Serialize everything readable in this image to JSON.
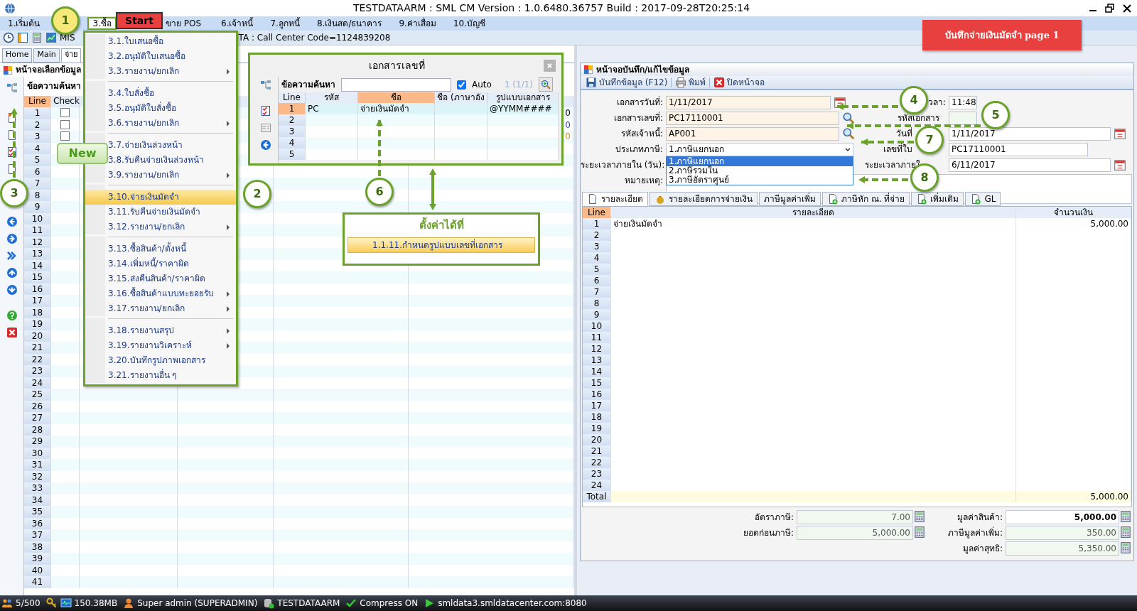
{
  "window": {
    "title": "TESTDATAARM : SML CM Version : 1.0.6480.36757  Build : 2017-09-28T20:25:14"
  },
  "menu_bar": [
    {
      "label": "1.เริ่มต้น",
      "selected": false
    },
    {
      "label": "3.ซื้อ",
      "selected": true
    },
    {
      "label": "ขาย POS",
      "selected": false
    },
    {
      "label": "6.เจ้าหนี้",
      "selected": false
    },
    {
      "label": "7.ลูกหนี้",
      "selected": false
    },
    {
      "label": "8.เงินสด/ธนาคาร",
      "selected": false
    },
    {
      "label": "9.ค่าเสื่อม",
      "selected": false
    },
    {
      "label": "10.บัญชี",
      "selected": false
    }
  ],
  "toolbar": {
    "mis_label": "MIS",
    "info": "TA : Call Center Code=1124839208"
  },
  "banner": "บันทึกจ่ายเงินมัดจำ page 1",
  "start_label": "Start",
  "left_panel": {
    "tabs": [
      {
        "label": "Home",
        "selected": false
      },
      {
        "label": "Main",
        "selected": false
      },
      {
        "label": "จ่าย",
        "selected": true
      }
    ],
    "title": "หน้าจอเลือกข้อมูล",
    "search_label": "ข้อความค้นหา",
    "columns": [
      "Line",
      "Check"
    ],
    "lines": [
      "1",
      "2",
      "3",
      "4",
      "5",
      "6",
      "7",
      "8",
      "9",
      "10",
      "11",
      "12",
      "13",
      "14",
      "15",
      "16",
      "17",
      "18",
      "19",
      "20",
      "21",
      "22",
      "23",
      "24",
      "25",
      "26",
      "27",
      "28",
      "29",
      "30",
      "31",
      "32",
      "33",
      "34",
      "35",
      "36",
      "37",
      "38",
      "39",
      "40",
      "41"
    ],
    "checks": [
      false,
      false,
      false
    ],
    "tails": [
      {
        "text": "0",
        "color": "#000000"
      },
      {
        "text": "0",
        "color": "#2a3fd0"
      },
      {
        "text": "0",
        "color": "#f08a00"
      }
    ]
  },
  "purchase_menu": [
    [
      {
        "label": "3.1.ใบเสนอซื้อ",
        "submenu": false,
        "selected": false
      },
      {
        "label": "3.2.อนุมัติใบเสนอซื้อ",
        "submenu": false,
        "selected": false
      },
      {
        "label": "3.3.รายงาน/ยกเลิก",
        "submenu": true,
        "selected": false
      }
    ],
    [
      {
        "label": "3.4.ใบสั่งซื้อ",
        "submenu": false,
        "selected": false
      },
      {
        "label": "3.5.อนุมัติใบสั่งซื้อ",
        "submenu": false,
        "selected": false
      },
      {
        "label": "3.6.รายงาน/ยกเลิก",
        "submenu": true,
        "selected": false
      }
    ],
    [
      {
        "label": "3.7.จ่ายเงินล่วงหน้า",
        "submenu": false,
        "selected": false
      },
      {
        "label": "3.8.รับคืนจ่ายเงินล่วงหน้า",
        "submenu": false,
        "selected": false
      },
      {
        "label": "3.9.รายงาน/ยกเลิก",
        "submenu": true,
        "selected": false
      }
    ],
    [
      {
        "label": "3.10.จ่ายเงินมัดจำ",
        "submenu": false,
        "selected": true
      },
      {
        "label": "3.11.รับคืนจ่ายเงินมัดจำ",
        "submenu": false,
        "selected": false
      },
      {
        "label": "3.12.รายงาน/ยกเลิก",
        "submenu": true,
        "selected": false
      }
    ],
    [
      {
        "label": "3.13.ซื้อสินค้า/ตั้งหนี้",
        "submenu": false,
        "selected": false
      },
      {
        "label": "3.14.เพิ่มหนี้/ราคาผิด",
        "submenu": false,
        "selected": false
      },
      {
        "label": "3.15.ส่งคืนสินค้า/ราคาผิด",
        "submenu": false,
        "selected": false
      },
      {
        "label": "3.16.ซื้อสินค้าแบบทะยอยรับ",
        "submenu": true,
        "selected": false
      },
      {
        "label": "3.17.รายงาน/ยกเลิก",
        "submenu": true,
        "selected": false
      }
    ],
    [
      {
        "label": "3.18.รายงานสรุป",
        "submenu": true,
        "selected": false
      },
      {
        "label": "3.19.รายงานวิเคราะห์",
        "submenu": true,
        "selected": false
      },
      {
        "label": "3.20.บันทึกรูปภาพเอกสาร",
        "submenu": false,
        "selected": false
      },
      {
        "label": "3.21.รายงานอื่น ๆ",
        "submenu": false,
        "selected": false
      }
    ]
  ],
  "popup": {
    "title": "เอกสารเลขที่",
    "search_label": "ข้อความค้นหา",
    "auto_checked": true,
    "auto_label": "Auto",
    "count": "1 (1/1)",
    "columns": [
      {
        "label": "Line",
        "selected": false
      },
      {
        "label": "รหัส",
        "selected": false
      },
      {
        "label": "ชื่อ",
        "selected": true
      },
      {
        "label": "ชื่อ (ภาษาอัง",
        "selected": false
      },
      {
        "label": "รูปแบบเอกสาร",
        "selected": false
      }
    ],
    "rows": [
      {
        "line": "1",
        "selected": true,
        "code": "PC",
        "name": "จ่ายเงินมัดจำ",
        "format": "@YYMM####"
      },
      {
        "line": "2",
        "selected": false
      },
      {
        "line": "3",
        "selected": false
      },
      {
        "line": "4",
        "selected": false
      },
      {
        "line": "5",
        "selected": false
      }
    ]
  },
  "setting_hint": {
    "title": "ตั้งค่าได้ที่",
    "item": "1.1.11.กำหนดรูปแบบเลขที่เอกสาร"
  },
  "new_tooltip": "New",
  "annotations": [
    {
      "label": "1",
      "color": "#f6e97a"
    },
    {
      "label": "3",
      "color": "#ffffff"
    },
    {
      "label": "2",
      "color": "#ffffff"
    },
    {
      "label": "4",
      "color": "#ffffff"
    },
    {
      "label": "5",
      "color": "#ffffff"
    },
    {
      "label": "6",
      "color": "#ffffff"
    },
    {
      "label": "7",
      "color": "#ffffff"
    },
    {
      "label": "8",
      "color": "#ffffff"
    }
  ],
  "form": {
    "title": "หน้าจอบันทึก/แก้ไขข้อมูล",
    "actions": [
      "บันทึกข้อมูล (F12)",
      "พิมพ์",
      "ปิดหน้าจอ"
    ],
    "left_fields": [
      {
        "kind": "date",
        "label": "เอกสารวันที่:",
        "value": "1/11/2017"
      },
      {
        "kind": "lookup",
        "label": "เอกสารเลขที่:",
        "value": "PC17110001"
      },
      {
        "kind": "lookup",
        "label": "รหัสเจ้าหนี้:",
        "value": "AP001"
      },
      {
        "kind": "select",
        "label": "ประเภทภาษี:",
        "value": "1.ภาษีแยกนอก",
        "expanded": true,
        "options": [
          {
            "label": "1.ภาษีแยกนอก",
            "selected": true
          },
          {
            "label": "2.ภาษีรวมใน",
            "selected": false
          },
          {
            "label": "3.ภาษีอัตราศูนย์",
            "selected": false
          }
        ]
      },
      {
        "kind": "label",
        "label": "ระยะเวลาภายใน (วัน):"
      },
      {
        "kind": "memo",
        "label": "หมายเหตุ:"
      }
    ],
    "right_fields": [
      {
        "kind": "time",
        "label": "วลา:",
        "value": "11:48"
      },
      {
        "kind": "readonly",
        "label": "รหัสเอกสาร"
      },
      {
        "kind": "date",
        "label": "วันที่",
        "value": "1/11/2017"
      },
      {
        "kind": "text",
        "label": "เลขที่ใบ",
        "value": "PC17110001"
      },
      {
        "kind": "date",
        "label": "ระยะเวลาภายใ",
        "value": "6/11/2017"
      }
    ],
    "tabs": [
      {
        "label": "รายละเอียด",
        "selected": true
      },
      {
        "label": "รายละเอียดการจ่ายเงิน",
        "selected": false
      },
      {
        "label": "ภาษีมูลค่าเพิ่ม",
        "selected": false
      },
      {
        "label": "ภาษีหัก ณ. ที่จ่าย",
        "selected": false
      },
      {
        "label": "เพิ่มเติม",
        "selected": false
      },
      {
        "label": "GL",
        "selected": false
      }
    ],
    "detail_columns": [
      "Line",
      "รายละเอียด",
      "จำนวนเงิน"
    ],
    "detail_rows": [
      {
        "line": "1",
        "detail": "จ่ายเงินมัดจำ",
        "amount": "5,000.00"
      },
      {
        "line": "2"
      },
      {
        "line": "3"
      },
      {
        "line": "4"
      },
      {
        "line": "5"
      },
      {
        "line": "6"
      },
      {
        "line": "7"
      },
      {
        "line": "8"
      },
      {
        "line": "9"
      },
      {
        "line": "10"
      },
      {
        "line": "11"
      },
      {
        "line": "12"
      },
      {
        "line": "13"
      },
      {
        "line": "14"
      },
      {
        "line": "15"
      },
      {
        "line": "16"
      },
      {
        "line": "17"
      },
      {
        "line": "18"
      },
      {
        "line": "19"
      },
      {
        "line": "20"
      },
      {
        "line": "21"
      },
      {
        "line": "22"
      },
      {
        "line": "23"
      },
      {
        "line": "24"
      }
    ],
    "total": {
      "label": "Total",
      "amount": "5,000.00"
    },
    "summary": [
      {
        "label": "อัตราภาษี:",
        "value": "7.00",
        "kind": "readonly"
      },
      {
        "label": "มูลค่าสินค้า:",
        "value": "5,000.00",
        "kind": "editable"
      },
      {
        "label": "ยอดก่อนภาษี:",
        "value": "5,000.00",
        "kind": "readonly"
      },
      {
        "label": "ภาษีมูลค่าเพิ่ม:",
        "value": "350.00",
        "kind": "readonly"
      },
      {
        "label": "มูลค่าสุทธิ:",
        "value": "5,350.00",
        "kind": "readonly"
      }
    ]
  },
  "status_bar": [
    "5/500",
    "150.38MB",
    "Super admin (SUPERADMIN)",
    "TESTDATAARM",
    "Compress ON",
    "smldata3.smldatacenter.com:8080"
  ]
}
